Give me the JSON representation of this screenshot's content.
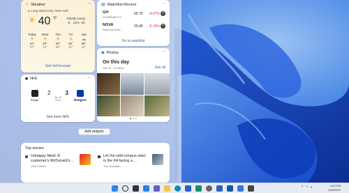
{
  "weather": {
    "title": "Weather",
    "location": "Long Island City, New York",
    "temp": "40",
    "unit": "°F",
    "condition": "Mostly sunny",
    "precip": "13%",
    "aqi": "63",
    "days": [
      {
        "name": "Today",
        "icon": "sun-icon",
        "high": "44°",
        "low": "27°"
      },
      {
        "name": "Wed",
        "icon": "sun-icon",
        "high": "40°",
        "low": "31°"
      },
      {
        "name": "Thu",
        "icon": "sun-icon",
        "high": "45°",
        "low": "39°"
      },
      {
        "name": "Fri",
        "icon": "sun-icon",
        "high": "52°",
        "low": "41°"
      },
      {
        "name": "Sat",
        "icon": "cloud-icon",
        "high": "55°",
        "low": "42°"
      }
    ],
    "footer": "See full forecast"
  },
  "watchlist": {
    "title": "Watchlist Movers",
    "rows": [
      {
        "symbol": "GH",
        "name": "GUARDANT H...",
        "price": "65.75",
        "change": "-4.87%"
      },
      {
        "symbol": "NOVA",
        "name": "Sunnova Ener...",
        "price": "20.40",
        "change": "-5.16%"
      }
    ],
    "footer": "Go to watchlist"
  },
  "photos": {
    "title": "Photos",
    "heading": "On this day",
    "subtitle": "Jan 25 - 21 items",
    "see_all": "See all"
  },
  "nhl": {
    "title": "NHL",
    "away_team": "Kings",
    "home_team": "Rangers",
    "away_score": "2",
    "home_score": "3",
    "status": "Final",
    "date": "Jan 24",
    "footer": "See more NHL"
  },
  "add_widgets": "Add widgets",
  "top_stories": {
    "title": "Top stories",
    "items": [
      {
        "headline": "Unhappy Meal: A customer's McDonald's ...",
        "source": "USA TODAY"
      },
      {
        "headline": "Let the wild rumpus start: is the FA facing a ...",
        "source": "The Guardian"
      }
    ]
  },
  "taskbar": {
    "time": "4:40 PM",
    "date": "1/25/2022"
  },
  "colors": {
    "negative": "#d13438",
    "accent": "#2a5fbf"
  }
}
